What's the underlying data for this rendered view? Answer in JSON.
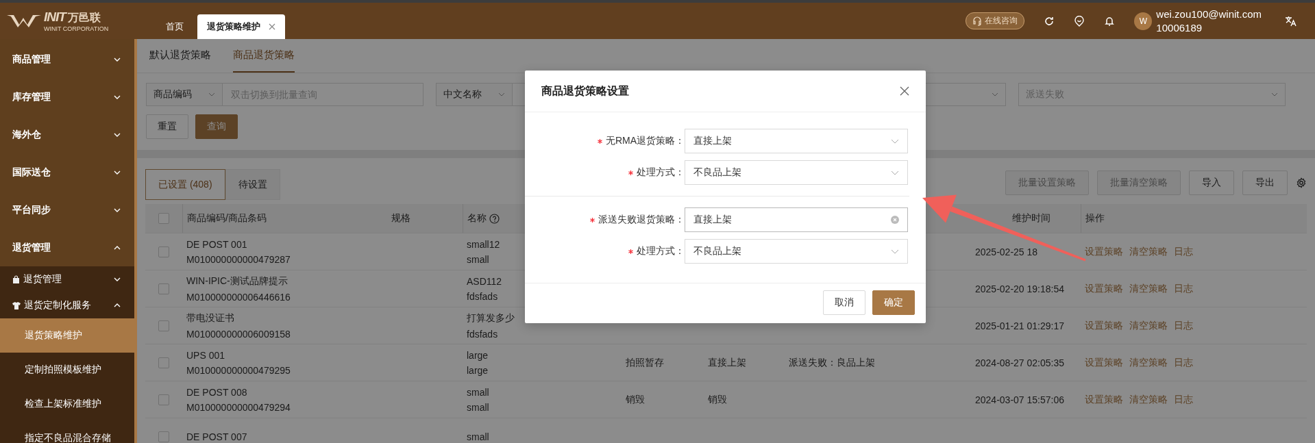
{
  "header": {
    "logo": {
      "mark": "INIT",
      "cn": "万邑联",
      "sub": "WINIT CORPORATION"
    },
    "tabs": [
      {
        "label": "首页",
        "selected": false,
        "closable": false
      },
      {
        "label": "退货策略维护",
        "selected": true,
        "closable": true
      }
    ],
    "consult": "在线咨询",
    "user": {
      "avatar": "W",
      "email": "wei.zou100@winit.com",
      "id": "10006189"
    }
  },
  "sidebar": {
    "items": [
      {
        "label": "商品管理",
        "expanded": false
      },
      {
        "label": "库存管理",
        "expanded": false
      },
      {
        "label": "海外仓",
        "expanded": false
      },
      {
        "label": "国际送仓",
        "expanded": false
      },
      {
        "label": "平台同步",
        "expanded": false
      },
      {
        "label": "退货管理",
        "expanded": true,
        "children": [
          {
            "label": "退货管理",
            "expanded": false
          },
          {
            "label": "退货定制化服务",
            "expanded": true,
            "children": [
              {
                "label": "退货策略维护",
                "selected": true
              },
              {
                "label": "定制拍照模板维护",
                "selected": false
              },
              {
                "label": "检查上架标准维护",
                "selected": false
              },
              {
                "label": "指定不良品混合存储",
                "selected": false
              }
            ]
          }
        ]
      }
    ]
  },
  "page_tabs": [
    {
      "label": "默认退货策略",
      "selected": false
    },
    {
      "label": "商品退货策略",
      "selected": true
    }
  ],
  "filters": [
    {
      "kind": "combo",
      "selector": "商品编码",
      "placeholder": "双击切换到批量查询"
    },
    {
      "kind": "combo",
      "selector": "中文名称"
    },
    {
      "kind": "select"
    },
    {
      "kind": "select",
      "placeholder": "派送失败"
    }
  ],
  "filter_buttons": [
    {
      "label": "重置",
      "primary": false
    },
    {
      "label": "查询",
      "primary": true
    }
  ],
  "list_tabs": [
    {
      "label": "已设置 (408)",
      "selected": true
    },
    {
      "label": "待设置",
      "selected": false
    }
  ],
  "toolbar": [
    {
      "label": "批量设置策略",
      "disabled": true
    },
    {
      "label": "批量清空策略",
      "disabled": true
    },
    {
      "label": "导入",
      "disabled": false
    },
    {
      "label": "导出",
      "disabled": false
    }
  ],
  "table": {
    "columns": {
      "code": "商品编码/商品条码",
      "spec": "规格",
      "name": "名称",
      "time": "维护时间",
      "actions": "操作"
    },
    "select_all_checked": false,
    "rows": [
      {
        "checked": false,
        "code": "DE POST 001",
        "barcode": "M010000000000479287",
        "name": "small12",
        "name_2": "small",
        "time": "2025-02-25 18",
        "actions": [
          "设置策略",
          "清空策略",
          "日志"
        ]
      },
      {
        "checked": false,
        "code": "WIN-IPIC-测试品牌提示",
        "barcode": "M010000000006446616",
        "name": "ASD112",
        "name_2": "fdsfads",
        "time": "2025-02-20 19:18:54",
        "actions": [
          "设置策略",
          "清空策略",
          "日志"
        ]
      },
      {
        "checked": false,
        "code": "带电没证书",
        "barcode": "M010000000006009158",
        "name": "打算发多少",
        "name_2": "fdsfads",
        "time": "2025-01-21 01:29:17",
        "actions": [
          "设置策略",
          "清空策略",
          "日志"
        ]
      },
      {
        "checked": false,
        "code": "UPS 001",
        "barcode": "M010000000000479295",
        "name": "large",
        "name_2": "large",
        "column_4": "拍照暂存",
        "column_5": "直接上架",
        "column_6": "派送失败：良品上架",
        "time": "2024-08-27 02:05:35",
        "actions": [
          "设置策略",
          "清空策略",
          "日志"
        ]
      },
      {
        "checked": false,
        "code": "DE POST 008",
        "barcode": "M010000000000479294",
        "name": "small",
        "name_2": "small",
        "column_4": "销毁",
        "column_5": "销毁",
        "time": "2024-03-07 15:57:06",
        "actions": [
          "设置策略",
          "清空策略",
          "日志"
        ]
      },
      {
        "checked": false,
        "code": "DE POST 007",
        "name": "small"
      }
    ]
  },
  "modal": {
    "title": "商品退货策略设置",
    "groups": [
      {
        "fields": [
          {
            "label": "无RMA退货策略：",
            "required": true,
            "value": "直接上架",
            "hovered": false
          },
          {
            "label": "处理方式：",
            "required": true,
            "value": "不良品上架",
            "hovered": false
          }
        ]
      },
      {
        "fields": [
          {
            "label": "派送失败退货策略：",
            "required": true,
            "value": "直接上架",
            "hovered": true
          },
          {
            "label": "处理方式：",
            "required": true,
            "value": "不良品上架",
            "hovered": false
          }
        ]
      }
    ],
    "buttons": [
      {
        "label": "取消",
        "primary": false
      },
      {
        "label": "确定",
        "primary": true
      }
    ]
  }
}
